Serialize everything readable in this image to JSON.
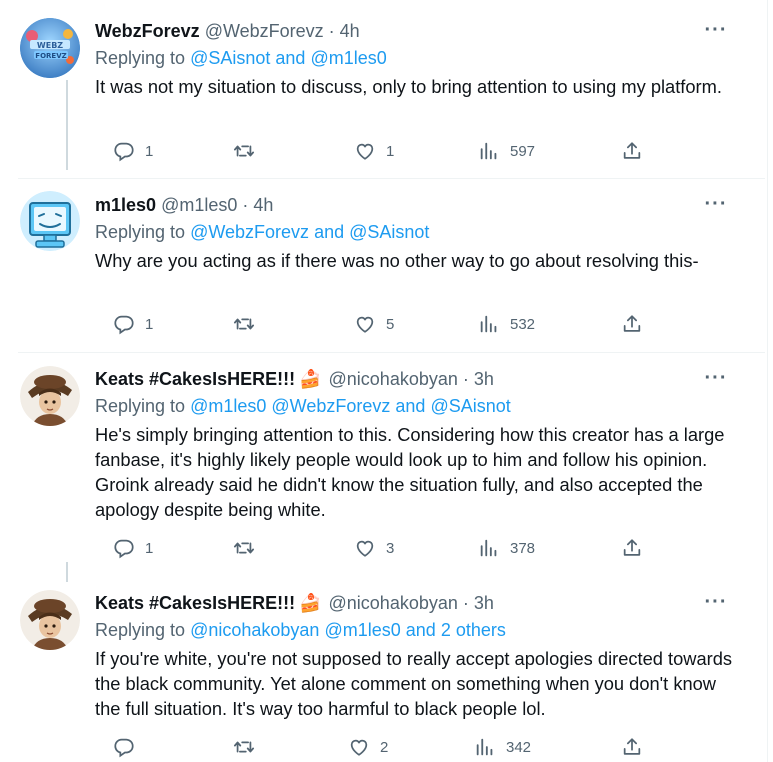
{
  "tweets": [
    {
      "name": "WebzForevz",
      "handle": "@WebzForevz",
      "time": "4h",
      "replying_prefix": "Replying to",
      "replying_links": [
        "@SAisnot",
        "@m1les0"
      ],
      "replying_join": "and",
      "text": "It was not my situation to discuss, only to bring attention to using my platform.",
      "replies": "1",
      "retweets": "",
      "likes": "1",
      "views": "597",
      "avatar_bg": "#5aa9e6"
    },
    {
      "name": "m1les0",
      "handle": "@m1les0",
      "time": "4h",
      "replying_prefix": "Replying to",
      "replying_links": [
        "@WebzForevz",
        "@SAisnot"
      ],
      "replying_join": "and",
      "text": "Why are you acting as if there was no other way to go about resolving this-",
      "replies": "1",
      "retweets": "",
      "likes": "5",
      "views": "532",
      "avatar_bg": "#8fd3f4"
    },
    {
      "name": "Keats #CakesIsHERE!!!",
      "handle": "@nicohakobyan",
      "time": "3h",
      "replying_prefix": "Replying to",
      "replying_links": [
        "@m1les0",
        "@WebzForevz",
        "@SAisnot"
      ],
      "replying_join": "and",
      "text": "He's simply bringing attention to this. Considering how this creator has a large fanbase, it's highly likely people would look up to him and follow his opinion. Groink already said he didn't know the situation fully, and also accepted the apology despite being white.",
      "replies": "1",
      "retweets": "",
      "likes": "3",
      "views": "378",
      "avatar_bg": "#f2ede6"
    },
    {
      "name": "Keats #CakesIsHERE!!!",
      "handle": "@nicohakobyan",
      "time": "3h",
      "replying_prefix": "Replying to",
      "replying_links": [
        "@nicohakobyan",
        "@m1les0"
      ],
      "replying_join": "and 2 others",
      "text": "If you're white, you're not supposed to really accept apologies directed towards the black community. Yet alone comment on something when you don't know the full situation. It's way too harmful to black people lol.",
      "replies": "",
      "retweets": "",
      "likes": "2",
      "views": "342",
      "avatar_bg": "#f2ede6"
    }
  ],
  "ui": {
    "dot": "·",
    "more": "···",
    "cake_emoji": "🍰"
  }
}
